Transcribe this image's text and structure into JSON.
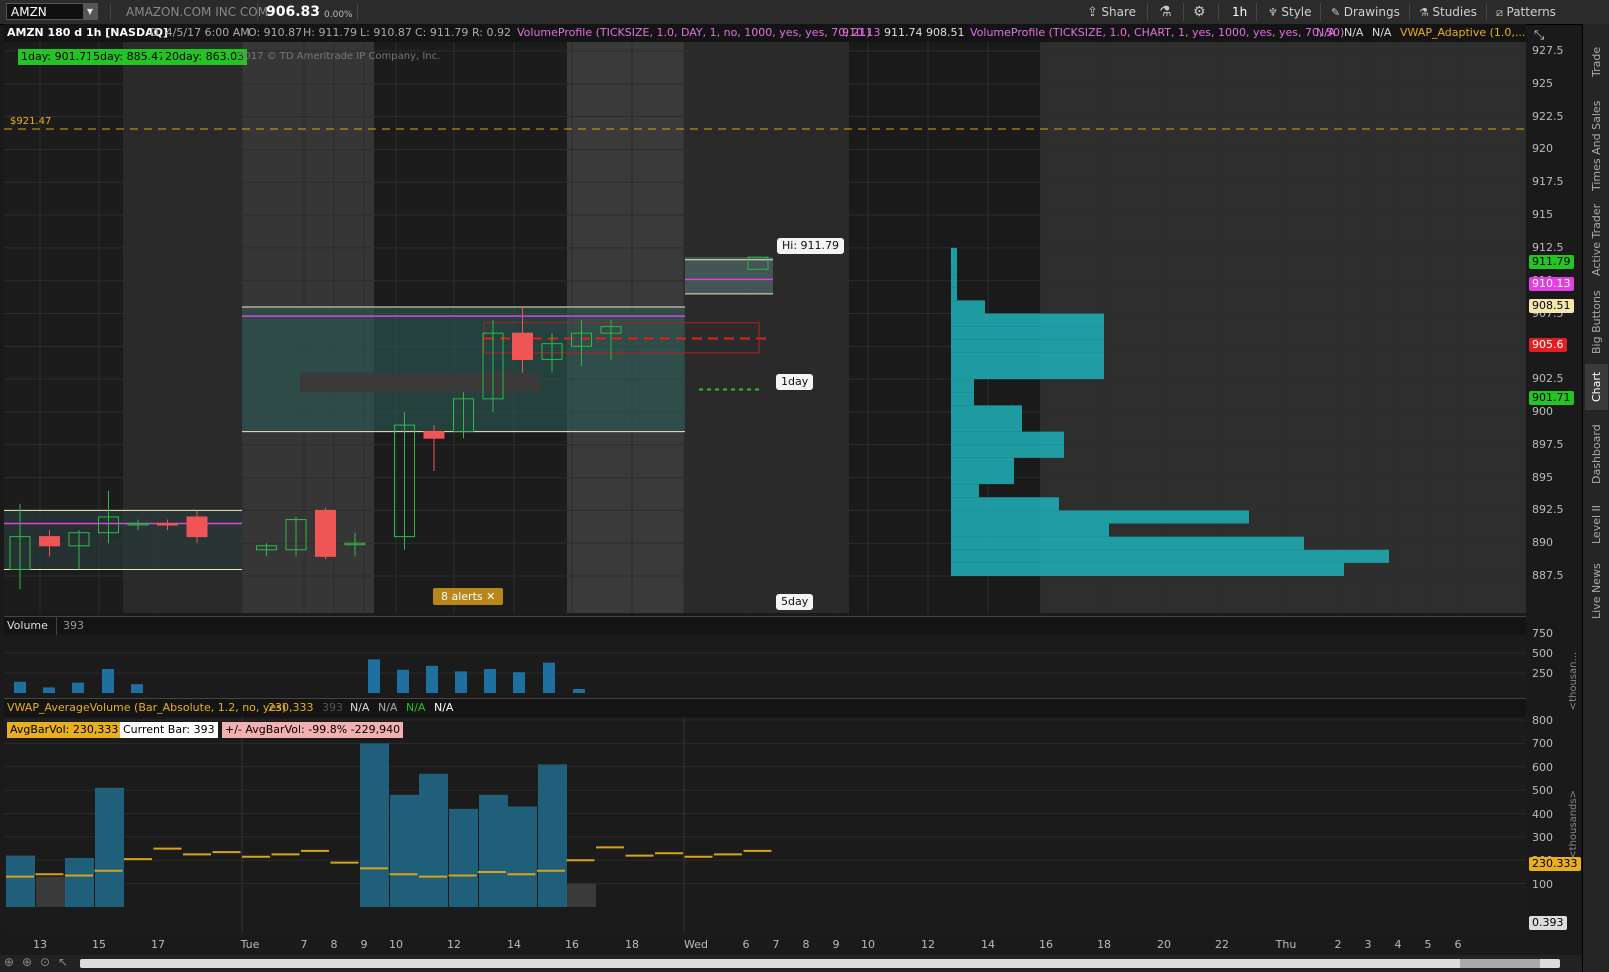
{
  "toolbar": {
    "symbol": "AMZN",
    "company": "AMAZON.COM INC COM",
    "last": "906.83",
    "change": "0.00%",
    "share": "Share",
    "interval": "1h",
    "style": "Style",
    "drawings": "Drawings",
    "studies": "Studies",
    "patterns": "Patterns"
  },
  "chart_header": {
    "title": "AMZN 180 d 1h [NASDAQ]",
    "date": "D: 4/5/17 6:00 AM",
    "open": "O: 910.87",
    "high": "H: 911.79",
    "low": "L: 910.87",
    "close": "C: 911.79",
    "range": "R: 0.92",
    "vp1": "VolumeProfile (TICKSIZE, 1.0, DAY, 1, no, 1000, yes, yes, 70, 21)",
    "vp1_v1": "910.13",
    "vp1_v2": "911.74",
    "vp1_v3": "908.51",
    "vp2": "VolumeProfile (TICKSIZE, 1.0, CHART, 1, yes, 1000, yes, yes, 70, 50)",
    "na1": "N/A",
    "na2": "N/A",
    "na3": "N/A",
    "vwap": "VWAP_Adaptive (1.0,...",
    "ma1": "1day: 901.71",
    "ma5": "5day: 885.47",
    "ma20": "20day: 863.03",
    "copyright": "2017 © TD Ameritrade IP Company, Inc."
  },
  "annotations": {
    "alert_line": "$921.47",
    "hi_bubble": "Hi: 911.79",
    "day1_bubble": "1day",
    "day5_bubble": "5day",
    "alerts": "8 alerts"
  },
  "price_labels": {
    "l1": "911.79",
    "l2": "910.13",
    "l3": "908.51",
    "l4": "905.6",
    "l5": "901.71"
  },
  "volume_panel": {
    "title": "Volume",
    "value": "393",
    "unit": "<thousan..."
  },
  "vwap_panel": {
    "title": "VWAP_AverageVolume (Bar_Absolute, 1.2, no, yes)",
    "value": "230,333",
    "v2": "393",
    "na1": "N/A",
    "na2": "N/A",
    "na3": "N/A",
    "na4": "N/A",
    "avgbar": "AvgBarVol: 230,333",
    "current": "Current Bar: 393",
    "diff": "+/- AvgBarVol:  -99.8%  -229,940",
    "unit": "<thousands>",
    "label_avg": "230.333",
    "label_cur": "0.393"
  },
  "sidebar": [
    "Trade",
    "Times And Sales",
    "Active Trader",
    "Big Buttons",
    "Chart",
    "Dashboard",
    "Level II",
    "Live News"
  ],
  "colors": {
    "up": "#2fb84a",
    "down": "#f05555",
    "profile": "#1fa8b0",
    "alert": "#d9a21b",
    "vwapbar": "#1f5f7a"
  },
  "chart_data": {
    "type": "candlestick",
    "price_axis": {
      "ticks": [
        927.5,
        925,
        922.5,
        920,
        917.5,
        915,
        912.5,
        910,
        907.5,
        905,
        902.5,
        900,
        897.5,
        895,
        892.5,
        890,
        887.5
      ]
    },
    "candles": [
      {
        "o": 888,
        "h": 893,
        "l": 886.5,
        "c": 890.5
      },
      {
        "o": 890.5,
        "h": 891,
        "l": 889,
        "c": 889.8
      },
      {
        "o": 889.8,
        "h": 891,
        "l": 888,
        "c": 890.8
      },
      {
        "o": 890.8,
        "h": 894,
        "l": 890,
        "c": 892
      },
      {
        "o": 891.5,
        "h": 891.8,
        "l": 891,
        "c": 891.5
      },
      {
        "o": 891.5,
        "h": 891.8,
        "l": 891,
        "c": 891.4
      },
      {
        "o": 892,
        "h": 892.5,
        "l": 890,
        "c": 890.5
      },
      {
        "o": 889.5,
        "h": 890,
        "l": 889,
        "c": 889.8
      },
      {
        "o": 889.5,
        "h": 892,
        "l": 889,
        "c": 891.8
      },
      {
        "o": 892.5,
        "h": 892.7,
        "l": 888.8,
        "c": 889
      },
      {
        "o": 890,
        "h": 890.8,
        "l": 889,
        "c": 890
      },
      {
        "o": 890.5,
        "h": 900,
        "l": 889.5,
        "c": 899
      },
      {
        "o": 898.5,
        "h": 899,
        "l": 895.5,
        "c": 898
      },
      {
        "o": 898.5,
        "h": 901.5,
        "l": 898,
        "c": 901
      },
      {
        "o": 901,
        "h": 907,
        "l": 900,
        "c": 906
      },
      {
        "o": 906,
        "h": 908,
        "l": 903,
        "c": 904
      },
      {
        "o": 904,
        "h": 906,
        "l": 903,
        "c": 905.2
      },
      {
        "o": 905,
        "h": 907,
        "l": 903.5,
        "c": 906
      },
      {
        "o": 906,
        "h": 907,
        "l": 904,
        "c": 906.5
      }
    ],
    "volume_axis": {
      "ticks": [
        750,
        500,
        250
      ]
    },
    "vwap_axis": {
      "ticks": [
        800,
        700,
        600,
        500,
        400,
        300,
        200,
        100
      ]
    },
    "volume": [
      140,
      70,
      130,
      300,
      110,
      0,
      0,
      0,
      0,
      0,
      0,
      0,
      420,
      290,
      340,
      270,
      300,
      260,
      380,
      50
    ],
    "vwap_bars": [
      220,
      130,
      210,
      510,
      0,
      0,
      0,
      0,
      0,
      0,
      0,
      0,
      700,
      480,
      570,
      420,
      480,
      430,
      610,
      100
    ],
    "time_ticks": [
      "13",
      "15",
      "17",
      "Tue",
      "7",
      "8",
      "9",
      "10",
      "12",
      "14",
      "16",
      "18",
      "Wed",
      "6",
      "7",
      "8",
      "9",
      "10",
      "12",
      "14",
      "16",
      "18",
      "20",
      "22",
      "Thu",
      "2",
      "3",
      "4",
      "5",
      "6"
    ]
  }
}
